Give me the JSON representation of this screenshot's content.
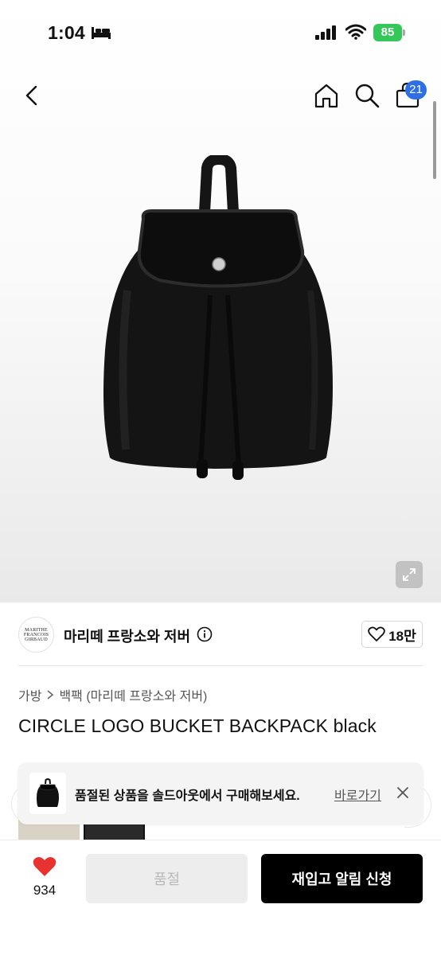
{
  "status_bar": {
    "time": "1:04",
    "battery": "85"
  },
  "header": {
    "cart_count": "21"
  },
  "brand": {
    "logo_lines": [
      "MARITHE",
      "FRANCOIS",
      "GIRBAUD"
    ],
    "name": "마리떼 프랑소와 저버",
    "likes": "18만"
  },
  "product": {
    "breadcrumb": [
      "가방",
      "백팩 (마리떼 프랑소와 저버)"
    ],
    "title": "CIRCLE LOGO BUCKET BACKPACK black"
  },
  "toast": {
    "message": "품절된 상품을 솔드아웃에서 구매해보세요.",
    "link": "바로가기"
  },
  "bottom_bar": {
    "wish_count": "934",
    "soldout_label": "품절",
    "restock_label": "재입고 알림 신청"
  },
  "colors": {
    "accent_badge": "#2f6fe6",
    "battery": "#34c759",
    "heart": "#e8322f",
    "cta": "#000000"
  },
  "icons": [
    "bed-icon",
    "signal-icon",
    "wifi-icon",
    "back-icon",
    "home-icon",
    "search-icon",
    "cart-icon",
    "expand-icon",
    "info-icon",
    "heart-outline-icon",
    "close-icon",
    "heart-filled-icon"
  ]
}
